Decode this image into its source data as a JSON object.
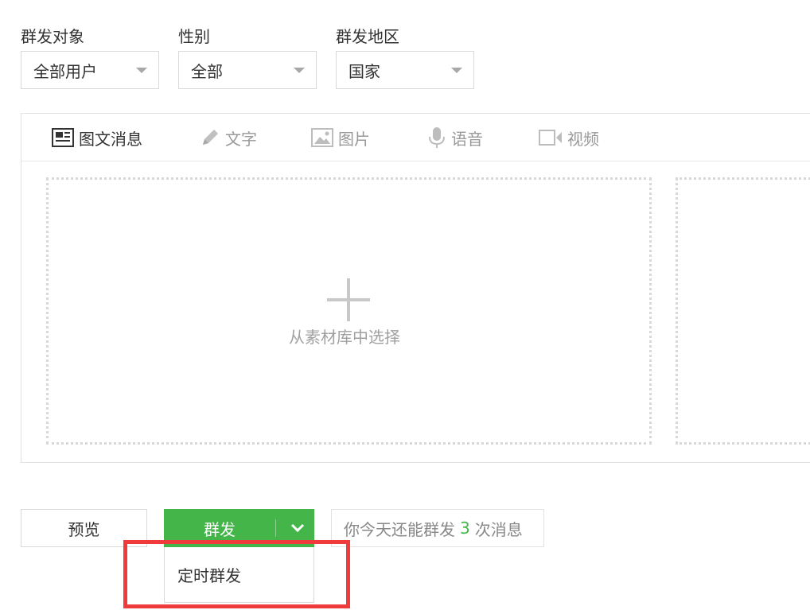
{
  "filters": {
    "target": {
      "label": "群发对象",
      "value": "全部用户"
    },
    "gender": {
      "label": "性别",
      "value": "全部"
    },
    "region": {
      "label": "群发地区",
      "value": "国家"
    }
  },
  "tabs": [
    {
      "label": "图文消息",
      "icon": "news-icon",
      "active": true
    },
    {
      "label": "文字",
      "icon": "pencil-icon",
      "active": false
    },
    {
      "label": "图片",
      "icon": "image-icon",
      "active": false
    },
    {
      "label": "语音",
      "icon": "microphone-icon",
      "active": false
    },
    {
      "label": "视频",
      "icon": "video-icon",
      "active": false
    }
  ],
  "editor": {
    "select_from_library": "从素材库中选择"
  },
  "actions": {
    "preview": "预览",
    "send": "群发",
    "quota_prefix": "你今天还能群发",
    "quota_count": "3",
    "quota_suffix": "次消息",
    "dropdown_item": "定时群发"
  },
  "colors": {
    "primary_green": "#44b549",
    "highlight_red": "#ef3b3b"
  }
}
